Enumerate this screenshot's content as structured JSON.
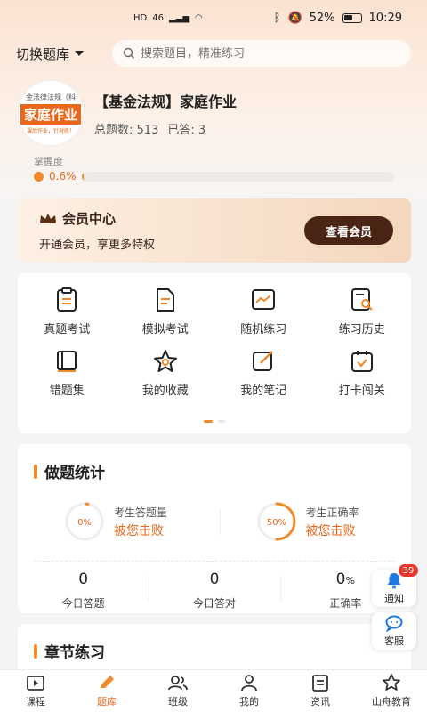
{
  "status_bar": {
    "left": [
      "HD",
      "46",
      "ill",
      "WiFi"
    ],
    "battery": "52%",
    "time": "10:29"
  },
  "header": {
    "bank_switch": "切换题库",
    "search_placeholder": "搜索题目，精准练习"
  },
  "course": {
    "cover_top": "金法律法规（科",
    "cover_main": "家庭作业",
    "cover_bottom": "课后作业，针对练！",
    "title": "【基金法规】家庭作业",
    "total_label": "总题数:",
    "total": "513",
    "answered_label": "已答:",
    "answered": "3"
  },
  "mastery": {
    "label": "掌握度",
    "percent_text": "0.6%",
    "percent": 0.6
  },
  "member": {
    "title": "会员中心",
    "subtitle": "开通会员，享更多特权",
    "button": "查看会员"
  },
  "menu": {
    "items": [
      {
        "label": "真题考试",
        "icon": "exam-paper-icon"
      },
      {
        "label": "模拟考试",
        "icon": "document-icon"
      },
      {
        "label": "随机练习",
        "icon": "trend-chart-icon"
      },
      {
        "label": "练习历史",
        "icon": "history-search-icon"
      },
      {
        "label": "错题集",
        "icon": "book-icon"
      },
      {
        "label": "我的收藏",
        "icon": "star-icon"
      },
      {
        "label": "我的笔记",
        "icon": "edit-note-icon"
      },
      {
        "label": "打卡闯关",
        "icon": "calendar-check-icon"
      }
    ]
  },
  "stats": {
    "title": "做题统计",
    "cards": [
      {
        "ring_text": "0%",
        "ring_value": 0,
        "label": "考生答题量",
        "defeat": "被您击败"
      },
      {
        "ring_text": "50%",
        "ring_value": 50,
        "label": "考生正确率",
        "defeat": "被您击败"
      }
    ],
    "bottom": [
      {
        "value": "0",
        "unit": "",
        "label": "今日答题"
      },
      {
        "value": "0",
        "unit": "",
        "label": "今日答对"
      },
      {
        "value": "0",
        "unit": "%",
        "label": "正确率"
      }
    ]
  },
  "chapter": {
    "title": "章节练习"
  },
  "floating": {
    "notify_label": "通知",
    "notify_badge": "39",
    "service_label": "客服"
  },
  "nav": {
    "tabs": [
      {
        "label": "课程",
        "icon": "play-video-icon"
      },
      {
        "label": "题库",
        "icon": "pencil-icon"
      },
      {
        "label": "班级",
        "icon": "group-icon"
      },
      {
        "label": "我的",
        "icon": "person-icon"
      },
      {
        "label": "资讯",
        "icon": "news-icon"
      },
      {
        "label": "山舟教育",
        "icon": "star-outline-icon"
      }
    ],
    "active": 1
  },
  "colors": {
    "accent": "#e8671b",
    "accent_light": "#f08a2d",
    "member_button": "#4a2414"
  }
}
